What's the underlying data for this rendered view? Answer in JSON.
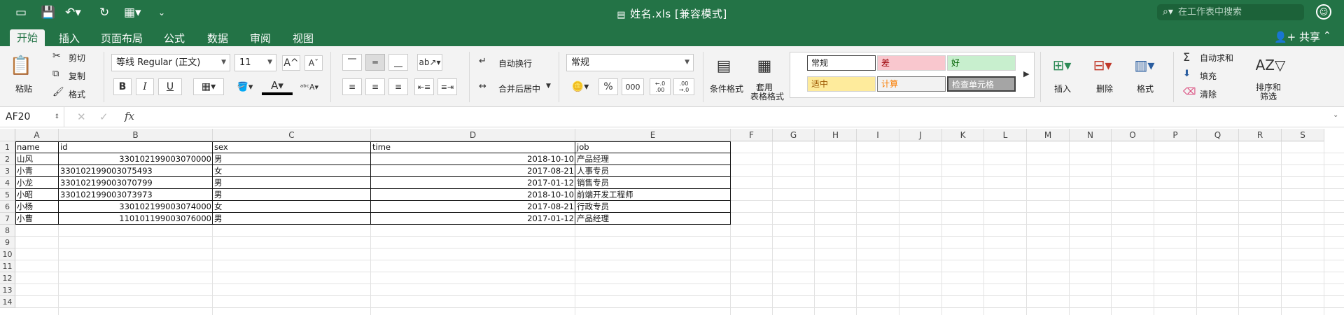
{
  "window": {
    "title": "姓名.xls  [兼容模式]",
    "search_placeholder": "在工作表中搜索"
  },
  "tabs": [
    "开始",
    "插入",
    "页面布局",
    "公式",
    "数据",
    "审阅",
    "视图"
  ],
  "share_label": "共享",
  "ribbon": {
    "paste": "粘贴",
    "cut": "剪切",
    "copy": "复制",
    "format_painter": "格式",
    "font_name": "等线 Regular (正文)",
    "font_size": "11",
    "bold": "B",
    "italic": "I",
    "underline": "U",
    "wrap_text": "自动换行",
    "merge_center": "合并后居中",
    "number_format": "常规",
    "percent": "%",
    "thousands": "000",
    "inc_decimal": "←.0 .00",
    "dec_decimal": ".00 →.0",
    "conditional_format": "条件格式",
    "table_format_1": "套用",
    "table_format_2": "表格格式",
    "styles": {
      "normal": "常规",
      "bad": "差",
      "good": "好",
      "neutral": "适中",
      "calculation": "计算",
      "check_cell": "检查单元格"
    },
    "insert": "插入",
    "delete": "删除",
    "format": "格式",
    "autosum": "自动求和",
    "fill": "填充",
    "clear": "清除",
    "sort_filter_1": "排序和",
    "sort_filter_2": "筛选"
  },
  "formula_bar": {
    "name_box": "AF20",
    "fx": "fx",
    "value": ""
  },
  "columns": [
    "A",
    "B",
    "C",
    "D",
    "E",
    "F",
    "G",
    "H",
    "I",
    "J",
    "K",
    "L",
    "M",
    "N",
    "O",
    "P",
    "Q",
    "R",
    "S"
  ],
  "rows": [
    "1",
    "2",
    "3",
    "4",
    "5",
    "6",
    "7",
    "8",
    "9",
    "10",
    "11",
    "12",
    "13",
    "14"
  ],
  "sheet": {
    "headers": [
      "name",
      "id",
      "sex",
      "time",
      "job"
    ],
    "data": [
      [
        "山风",
        "330102199003070000",
        "男",
        "2018-10-10",
        "产品经理"
      ],
      [
        "小青",
        "330102199003075493",
        "女",
        "2017-08-21",
        "人事专员"
      ],
      [
        "小龙",
        "330102199003070799",
        "男",
        "2017-01-12",
        "销售专员"
      ],
      [
        "小昭",
        "330102199003073973",
        "男",
        "2018-10-10",
        "前端开发工程师"
      ],
      [
        "小杨",
        "330102199003074000",
        "女",
        "2017-08-21",
        "行政专员"
      ],
      [
        "小曹",
        "110101199003076000",
        "男",
        "2017-01-12",
        "产品经理"
      ]
    ],
    "id_right_aligned": [
      true,
      false,
      false,
      false,
      true,
      true
    ]
  }
}
